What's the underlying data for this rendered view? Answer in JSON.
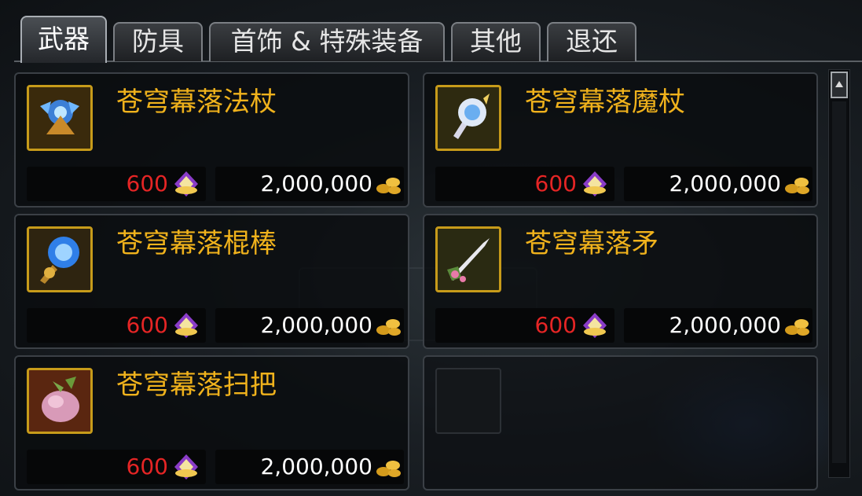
{
  "tabs": [
    {
      "label": "武器",
      "active": true
    },
    {
      "label": "防具",
      "active": false
    },
    {
      "label": "首饰 & 特殊装备",
      "active": false
    },
    {
      "label": "其他",
      "active": false
    },
    {
      "label": "退还",
      "active": false
    }
  ],
  "items": [
    {
      "name": "苍穹幕落法杖",
      "cera_price": "600",
      "gold_price": "2,000,000",
      "icon": "staff-icon"
    },
    {
      "name": "苍穹幕落魔杖",
      "cera_price": "600",
      "gold_price": "2,000,000",
      "icon": "wand-icon"
    },
    {
      "name": "苍穹幕落棍棒",
      "cera_price": "600",
      "gold_price": "2,000,000",
      "icon": "rod-icon"
    },
    {
      "name": "苍穹幕落矛",
      "cera_price": "600",
      "gold_price": "2,000,000",
      "icon": "spear-icon"
    },
    {
      "name": "苍穹幕落扫把",
      "cera_price": "600",
      "gold_price": "2,000,000",
      "icon": "broom-icon"
    }
  ],
  "colors": {
    "item_name": "#f0b21c",
    "cera_price": "#e52525",
    "gold_price": "#ffffff",
    "icon_border": "#c79b1a"
  }
}
